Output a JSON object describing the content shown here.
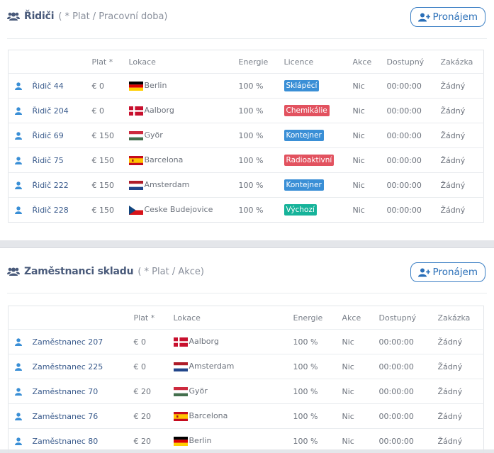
{
  "colors": {
    "accent": "#2a6fb8",
    "info": "#3a8fd6",
    "danger": "#e2525f",
    "success": "#16b39a"
  },
  "hire_label": "Pronájem",
  "drivers": {
    "title": "Řidiči",
    "subtitle": "( * Plat / Pracovní doba)",
    "columns": {
      "salary": "Plat *",
      "location": "Lokace",
      "energy": "Energie",
      "license": "Licence",
      "action": "Akce",
      "available": "Dostupný",
      "order": "Zakázka"
    },
    "rows": [
      {
        "name": "Řidič 44",
        "salary": "€ 0",
        "flag": "de",
        "location": "Berlin",
        "energy": "100 %",
        "license": "Sklápěcí",
        "license_type": "info",
        "action": "Nic",
        "available": "00:00:00",
        "order": "Žádný"
      },
      {
        "name": "Řidič 204",
        "salary": "€ 0",
        "flag": "dk",
        "location": "Aalborg",
        "energy": "100 %",
        "license": "Chemikálie",
        "license_type": "danger",
        "action": "Nic",
        "available": "00:00:00",
        "order": "Žádný"
      },
      {
        "name": "Řidič 69",
        "salary": "€ 150",
        "flag": "hu",
        "location": "Györ",
        "energy": "100 %",
        "license": "Kontejner",
        "license_type": "info",
        "action": "Nic",
        "available": "00:00:00",
        "order": "Žádný"
      },
      {
        "name": "Řidič 75",
        "salary": "€ 150",
        "flag": "es",
        "location": "Barcelona",
        "energy": "100 %",
        "license": "Radioaktivní",
        "license_type": "danger",
        "action": "Nic",
        "available": "00:00:00",
        "order": "Žádný"
      },
      {
        "name": "Řidič 222",
        "salary": "€ 150",
        "flag": "nl",
        "location": "Amsterdam",
        "energy": "100 %",
        "license": "Kontejner",
        "license_type": "info",
        "action": "Nic",
        "available": "00:00:00",
        "order": "Žádný"
      },
      {
        "name": "Řidič 228",
        "salary": "€ 150",
        "flag": "cz",
        "location": "Ceske Budejovice",
        "energy": "100 %",
        "license": "Výchozí",
        "license_type": "success",
        "action": "Nic",
        "available": "00:00:00",
        "order": "Žádný"
      }
    ]
  },
  "warehouse": {
    "title": "Zaměstnanci skladu",
    "subtitle": "( * Plat / Akce)",
    "columns": {
      "salary": "Plat *",
      "location": "Lokace",
      "energy": "Energie",
      "action": "Akce",
      "available": "Dostupný",
      "order": "Zakázka"
    },
    "rows": [
      {
        "name": "Zaměstnanec 207",
        "salary": "€ 0",
        "flag": "dk",
        "location": "Aalborg",
        "energy": "100 %",
        "action": "Nic",
        "available": "00:00:00",
        "order": "Žádný"
      },
      {
        "name": "Zaměstnanec 225",
        "salary": "€ 0",
        "flag": "nl",
        "location": "Amsterdam",
        "energy": "100 %",
        "action": "Nic",
        "available": "00:00:00",
        "order": "Žádný"
      },
      {
        "name": "Zaměstnanec 70",
        "salary": "€ 20",
        "flag": "hu",
        "location": "Györ",
        "energy": "100 %",
        "action": "Nic",
        "available": "00:00:00",
        "order": "Žádný"
      },
      {
        "name": "Zaměstnanec 76",
        "salary": "€ 20",
        "flag": "es",
        "location": "Barcelona",
        "energy": "100 %",
        "action": "Nic",
        "available": "00:00:00",
        "order": "Žádný"
      },
      {
        "name": "Zaměstnanec 80",
        "salary": "€ 20",
        "flag": "de",
        "location": "Berlin",
        "energy": "100 %",
        "action": "Nic",
        "available": "00:00:00",
        "order": "Žádný"
      }
    ]
  }
}
